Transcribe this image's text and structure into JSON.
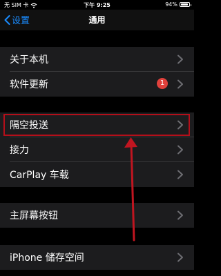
{
  "status_bar": {
    "carrier": "无 SIM 卡",
    "time": "下午 9:25",
    "battery_percent": "94%",
    "battery_level": 0.94
  },
  "nav": {
    "back_label": "设置",
    "title": "通用"
  },
  "groups": [
    [
      {
        "label": "关于本机"
      },
      {
        "label": "软件更新",
        "badge": "1"
      }
    ],
    [
      {
        "label": "隔空投送",
        "highlighted": true
      },
      {
        "label": "接力"
      },
      {
        "label": "CarPlay 车载"
      }
    ],
    [
      {
        "label": "主屏幕按钮"
      }
    ],
    [
      {
        "label": "iPhone 储存空间"
      }
    ]
  ],
  "colors": {
    "accent": "#1a8cff",
    "badge": "#e0413c",
    "annotation": "#c01520",
    "row_bg": "#1c1c1e",
    "background": "#000000"
  },
  "icons": {
    "back": "chevron-left-icon",
    "disclosure": "chevron-right-icon",
    "wifi": "wifi-icon",
    "battery": "battery-icon"
  }
}
